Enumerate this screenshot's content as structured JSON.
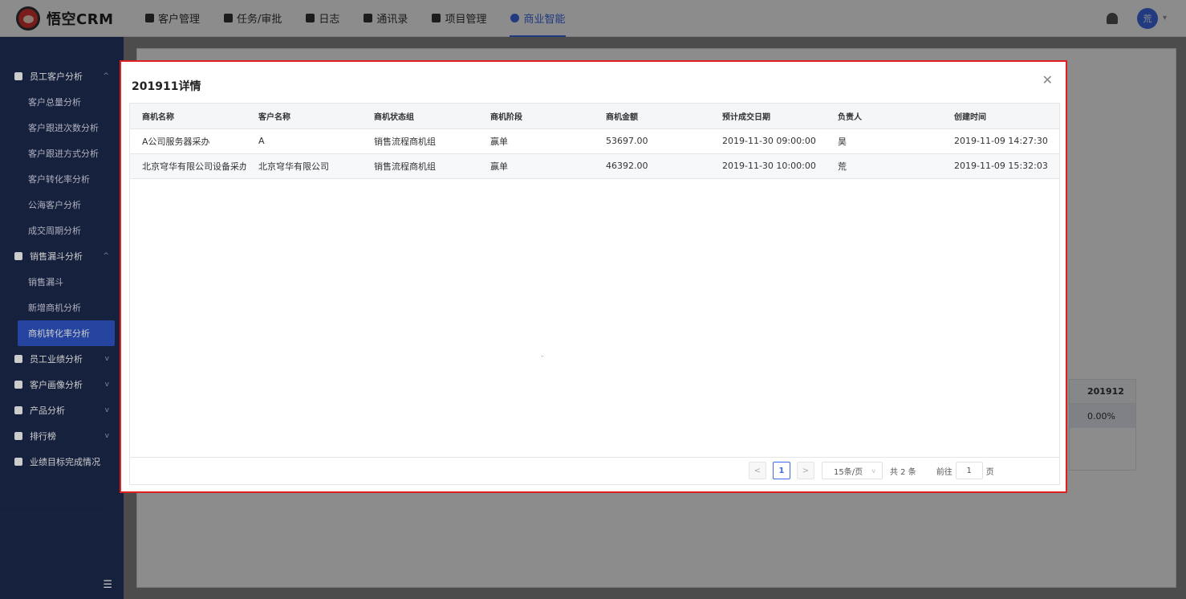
{
  "app": {
    "logo_text": "悟空CRM"
  },
  "nav": {
    "items": [
      {
        "label": "客户管理",
        "active": false
      },
      {
        "label": "任务/审批",
        "active": false
      },
      {
        "label": "日志",
        "active": false
      },
      {
        "label": "通讯录",
        "active": false
      },
      {
        "label": "项目管理",
        "active": false
      },
      {
        "label": "商业智能",
        "active": true
      }
    ],
    "user_avatar": "荒"
  },
  "sidebar": {
    "groups": [
      {
        "label": "员工客户分析",
        "icon": "user-icon",
        "expanded": true,
        "items": [
          "客户总量分析",
          "客户跟进次数分析",
          "客户跟进方式分析",
          "客户转化率分析",
          "公海客户分析",
          "成交周期分析"
        ]
      },
      {
        "label": "销售漏斗分析",
        "icon": "funnel-icon",
        "expanded": true,
        "items": [
          "销售漏斗",
          "新增商机分析",
          "商机转化率分析"
        ],
        "active_item": "商机转化率分析"
      },
      {
        "label": "员工业绩分析",
        "icon": "bar-chart-icon",
        "expanded": false,
        "items": []
      },
      {
        "label": "客户画像分析",
        "icon": "users-icon",
        "expanded": false,
        "items": []
      },
      {
        "label": "产品分析",
        "icon": "box-icon",
        "expanded": false,
        "items": []
      },
      {
        "label": "排行榜",
        "icon": "trophy-icon",
        "expanded": false,
        "items": []
      },
      {
        "label": "业绩目标完成情况",
        "icon": "target-icon",
        "expanded": false,
        "items": []
      }
    ],
    "toggle_icon": "collapse-menu-icon"
  },
  "background_table": {
    "header": "201912",
    "cell": "0.00%"
  },
  "modal": {
    "title": "201911详情",
    "columns": [
      "商机名称",
      "客户名称",
      "商机状态组",
      "商机阶段",
      "商机金额",
      "预计成交日期",
      "负责人",
      "创建时间"
    ],
    "rows": [
      [
        "A公司服务器采办",
        "A",
        "销售流程商机组",
        "赢单",
        "53697.00",
        "2019-11-30 09:00:00",
        "昊",
        "2019-11-09 14:27:30"
      ],
      [
        "北京穹华有限公司设备采办",
        "北京穹华有限公司",
        "销售流程商机组",
        "赢单",
        "46392.00",
        "2019-11-30 10:00:00",
        "荒",
        "2019-11-09 15:32:03"
      ]
    ],
    "pagination": {
      "prev": "<",
      "current_page": "1",
      "next": ">",
      "page_size": "15条/页",
      "total": "共 2 条",
      "jump_prefix": "前往",
      "jump_value": "1",
      "jump_suffix": "页"
    }
  },
  "colors": {
    "accent": "#3e6bea",
    "sidebar_bg": "#1c2a4d",
    "highlight_border": "#e02020"
  }
}
